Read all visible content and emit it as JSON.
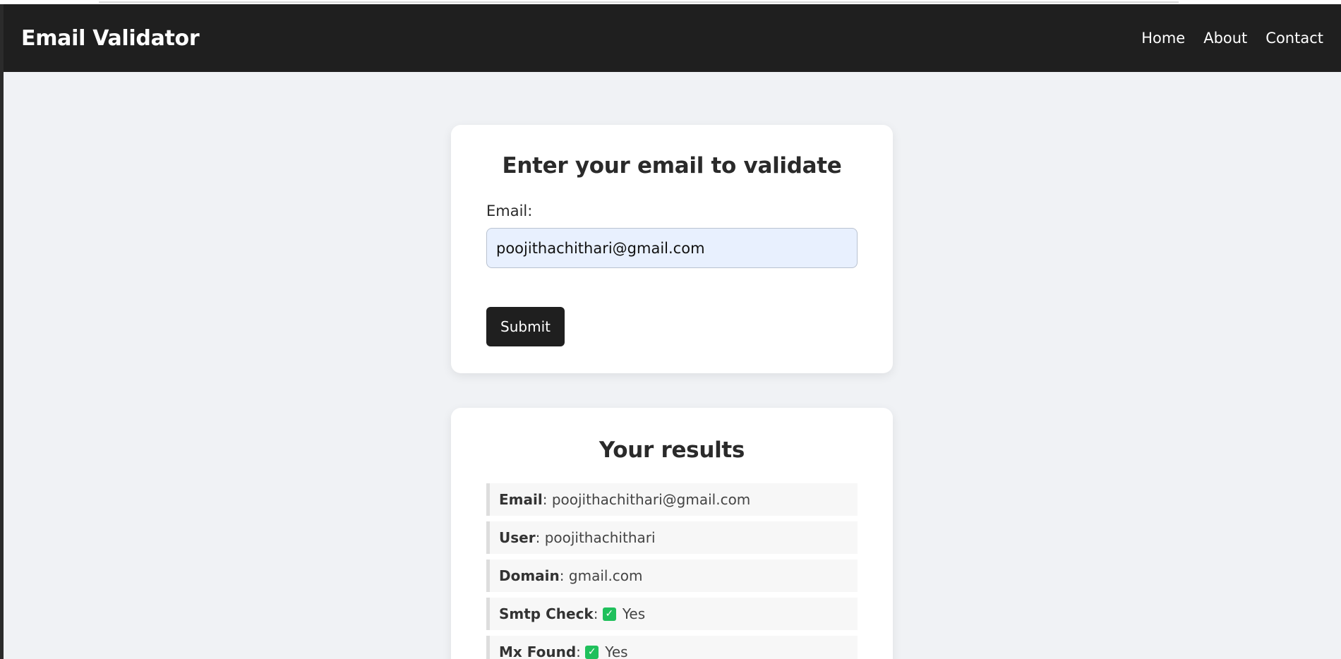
{
  "navbar": {
    "brand": "Email Validator",
    "links": [
      "Home",
      "About",
      "Contact"
    ]
  },
  "form": {
    "title": "Enter your email to validate",
    "email_label": "Email:",
    "email_value": "poojithachithari@gmail.com",
    "submit_label": "Submit"
  },
  "results": {
    "title": "Your results",
    "items": [
      {
        "key": "Email",
        "value": "poojithachithari@gmail.com"
      },
      {
        "key": "User",
        "value": "poojithachithari"
      },
      {
        "key": "Domain",
        "value": "gmail.com"
      },
      {
        "key": "Smtp Check",
        "value": "Yes",
        "icon": "check-icon"
      },
      {
        "key": "Mx Found",
        "value": "Yes",
        "icon": "check-icon"
      }
    ],
    "check_color": "#20c05c"
  }
}
